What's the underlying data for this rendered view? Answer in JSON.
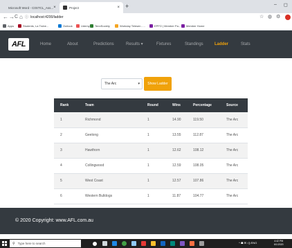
{
  "browser": {
    "tabs": [
      {
        "label": "Microsoft Word - C0STCL_Ass...",
        "favicon_color": "#2b579a"
      },
      {
        "label": "Project",
        "favicon_color": "#333333"
      }
    ],
    "new_tab": "+",
    "window_controls": {
      "minimize": "–",
      "maximize": "◻"
    },
    "tab_close": "×",
    "url": "localhost:4200/ladder",
    "nav": {
      "back": "←",
      "forward": "→",
      "reload": "C",
      "home": "⌂"
    },
    "url_info_icon": "ⓘ",
    "ext_icons": {
      "star": "☆",
      "ext1": "◍",
      "ext2": "⚙"
    },
    "bookmarks": [
      {
        "label": "Apps",
        "color": "#5f6368"
      },
      {
        "label": "Students, La Trobe...",
        "color": "#a50021"
      },
      {
        "label": "Outlook",
        "color": "#0078d4"
      },
      {
        "label": "Udemy",
        "color": "#ec5252"
      },
      {
        "label": "TennSociety",
        "color": "#2e7d32"
      },
      {
        "label": "Workday Telesen - ...",
        "color": "#f5a623"
      },
      {
        "label": "EPFO | Member Pa...",
        "color": "#7b1fa2"
      },
      {
        "label": "Member Home",
        "color": "#7b1fa2"
      }
    ]
  },
  "site": {
    "logo_text": "AFL",
    "nav": [
      {
        "label": "Home",
        "active": false
      },
      {
        "label": "About",
        "active": false
      },
      {
        "label": "Predictions",
        "active": false
      },
      {
        "label": "Results ▾",
        "active": false
      },
      {
        "label": "Fixtures",
        "active": false
      },
      {
        "label": "Standings",
        "active": false
      },
      {
        "label": "Ladder",
        "active": true
      },
      {
        "label": "Stats",
        "active": false
      }
    ],
    "accent_color": "#f0a20a"
  },
  "controls": {
    "source_select": "The Arc",
    "select_caret": "▾",
    "show_button": "Show Ladder"
  },
  "table": {
    "headers": [
      "Rank",
      "Team",
      "Round",
      "Wins",
      "Percentage",
      "Source"
    ],
    "rows": [
      [
        "1",
        "Richmond",
        "1",
        "14.90",
        "119.50",
        "The Arc"
      ],
      [
        "2",
        "Geelong",
        "1",
        "13.55",
        "112.87",
        "The Arc"
      ],
      [
        "3",
        "Hawthorn",
        "1",
        "12.62",
        "108.12",
        "The Arc"
      ],
      [
        "4",
        "Collingwood",
        "1",
        "12.59",
        "108.05",
        "The Arc"
      ],
      [
        "5",
        "West Coast",
        "1",
        "12.57",
        "107.86",
        "The Arc"
      ],
      [
        "6",
        "Western Bulldogs",
        "1",
        "11.87",
        "104.77",
        "The Arc"
      ]
    ]
  },
  "footer": {
    "copyright": "© 2020 Copyright: www.AFL.com.au"
  },
  "taskbar": {
    "search_placeholder": "Type here to search",
    "search_icon": "⚲",
    "tray_text": "^ ☗ ✉ ◁) ENG",
    "time": "4:42 PM",
    "date": "6/1/2020"
  }
}
